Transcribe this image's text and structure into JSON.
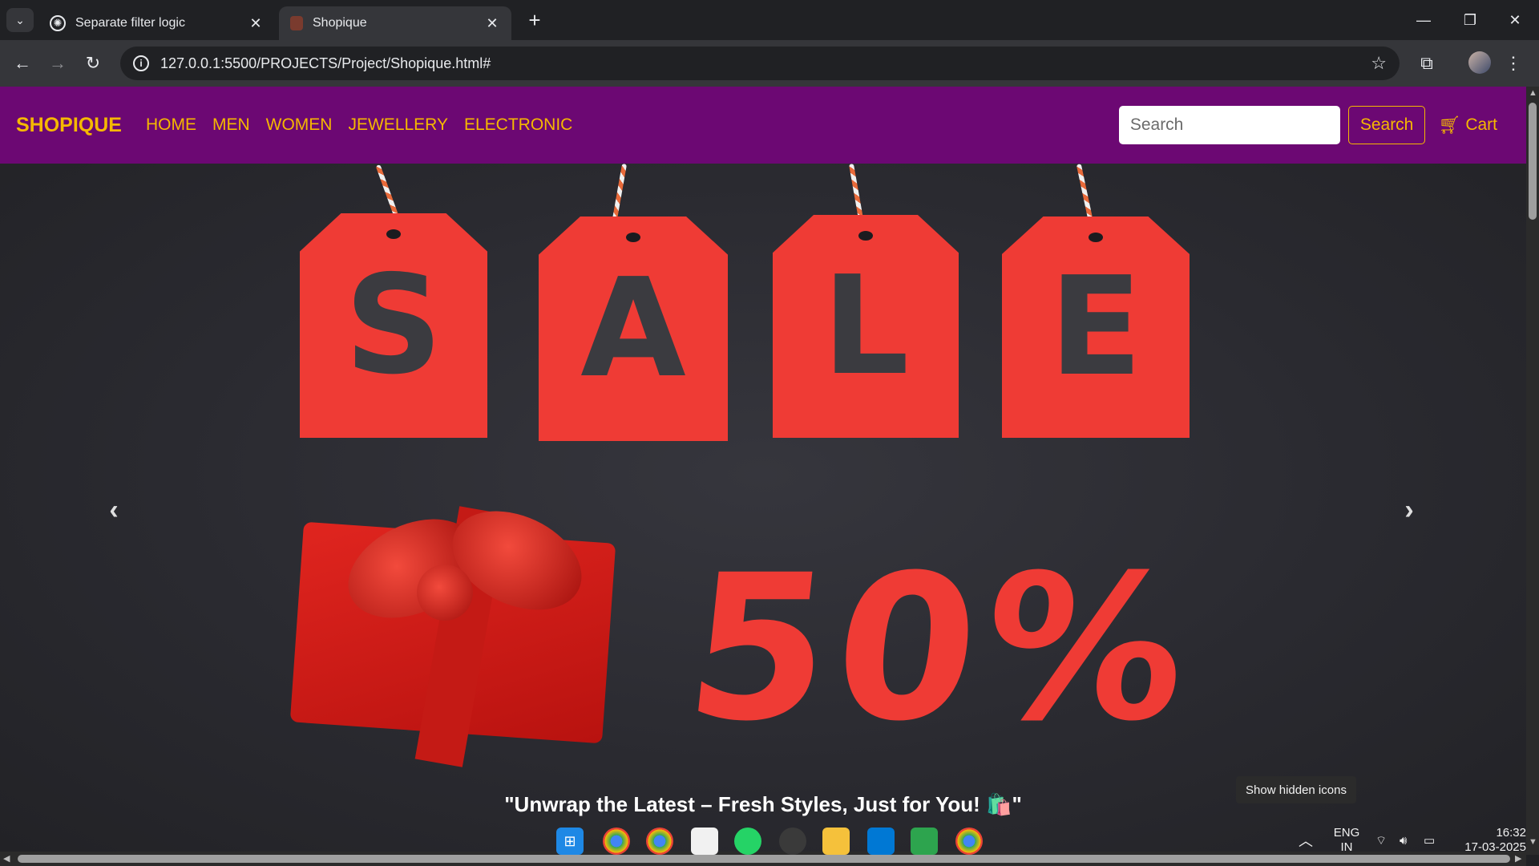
{
  "browser": {
    "tabs": [
      {
        "title": "Separate filter logic",
        "favicon": "openai-icon",
        "active": false
      },
      {
        "title": "Shopique",
        "favicon": "site-favicon",
        "active": true
      }
    ],
    "new_tab": "+",
    "tab_close": "✕",
    "url": "127.0.0.1:5500/PROJECTS/Project/Shopique.html#"
  },
  "site": {
    "brand": "SHOPIQUE",
    "nav": [
      "HOME",
      "MEN",
      "WOMEN",
      "JEWELLERY",
      "ELECTRONIC"
    ],
    "search_placeholder": "Search",
    "search_button": "Search",
    "cart_label": "Cart",
    "accent_color": "#f5b800",
    "navbar_color": "#6c0873"
  },
  "hero": {
    "tags": [
      "S",
      "A",
      "L",
      "E"
    ],
    "discount": "50%",
    "caption": "\"Unwrap the Latest – Fresh Styles, Just for You! 🛍️\""
  },
  "system": {
    "tooltip": "Show hidden icons",
    "lang_line1": "ENG",
    "lang_line2": "IN",
    "time": "16:32",
    "date": "17-03-2025"
  }
}
